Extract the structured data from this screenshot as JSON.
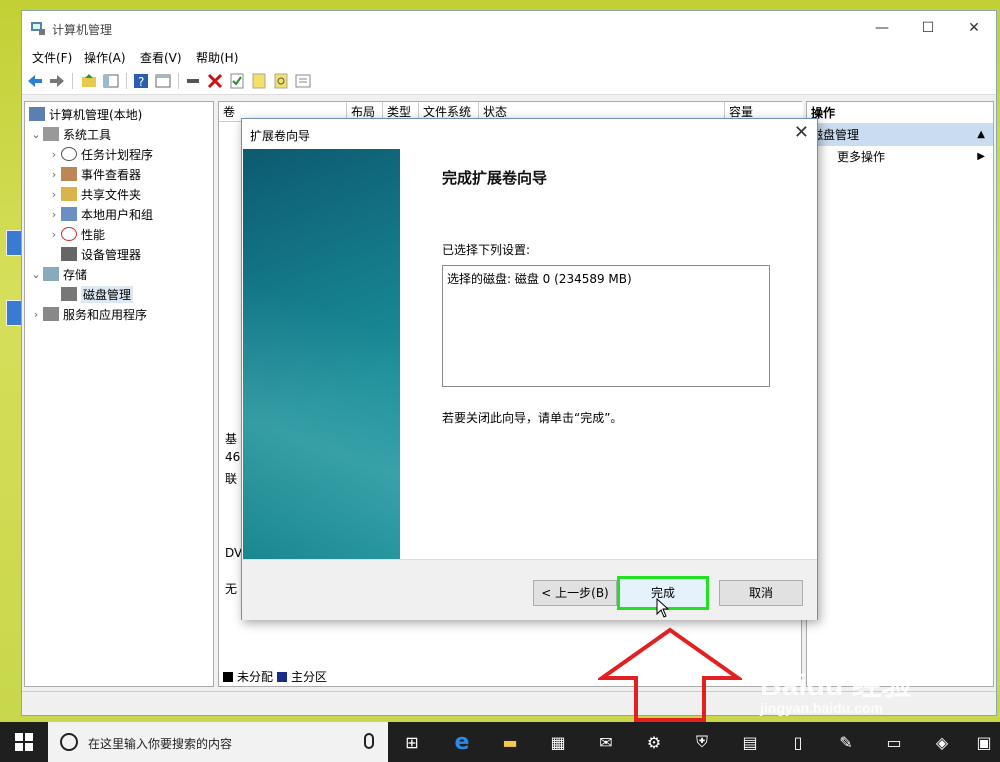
{
  "window": {
    "title": "计算机管理",
    "controls": {
      "minimize": "—",
      "maximize": "☐",
      "close": "✕"
    }
  },
  "menu": [
    "文件(F)",
    "操作(A)",
    "查看(V)",
    "帮助(H)"
  ],
  "tree": {
    "root": "计算机管理(本地)",
    "items": [
      {
        "label": "系统工具",
        "level": 1,
        "arrow": "⌄"
      },
      {
        "label": "任务计划程序",
        "level": 2,
        "arrow": "›"
      },
      {
        "label": "事件查看器",
        "level": 2,
        "arrow": "›"
      },
      {
        "label": "共享文件夹",
        "level": 2,
        "arrow": "›"
      },
      {
        "label": "本地用户和组",
        "level": 2,
        "arrow": "›"
      },
      {
        "label": "性能",
        "level": 2,
        "arrow": "›"
      },
      {
        "label": "设备管理器",
        "level": 2,
        "arrow": ""
      },
      {
        "label": "存储",
        "level": 1,
        "arrow": "⌄"
      },
      {
        "label": "磁盘管理",
        "level": 2,
        "arrow": ""
      },
      {
        "label": "服务和应用程序",
        "level": 1,
        "arrow": "›"
      }
    ]
  },
  "center": {
    "columns": [
      "卷",
      "布局",
      "类型",
      "文件系统",
      "状态",
      "容量"
    ],
    "partial_text": {
      "base": "基",
      "size": "46",
      "online": "联",
      "dvd": "DV",
      "none": "无"
    },
    "legend": {
      "unallocated": "未分配",
      "primary": "主分区"
    }
  },
  "actions": {
    "header": "操作",
    "section": "磁盘管理",
    "more": "更多操作"
  },
  "dialog": {
    "title": "扩展卷向导",
    "heading": "完成扩展卷向导",
    "selected_label": "已选择下列设置:",
    "selected_value": "选择的磁盘: 磁盘 0 (234589 MB)",
    "hint": "若要关闭此向导，请单击“完成”。",
    "buttons": {
      "back": "< 上一步(B)",
      "finish": "完成",
      "cancel": "取消"
    }
  },
  "taskbar": {
    "search_placeholder": "在这里输入你要搜索的内容"
  },
  "watermark": {
    "line1": "Baidu 经验",
    "line2": "jingyan.baidu.com"
  },
  "colors": {
    "highlight_border": "#22e022",
    "arrow": "#e32020",
    "banner": "#147a8a"
  }
}
